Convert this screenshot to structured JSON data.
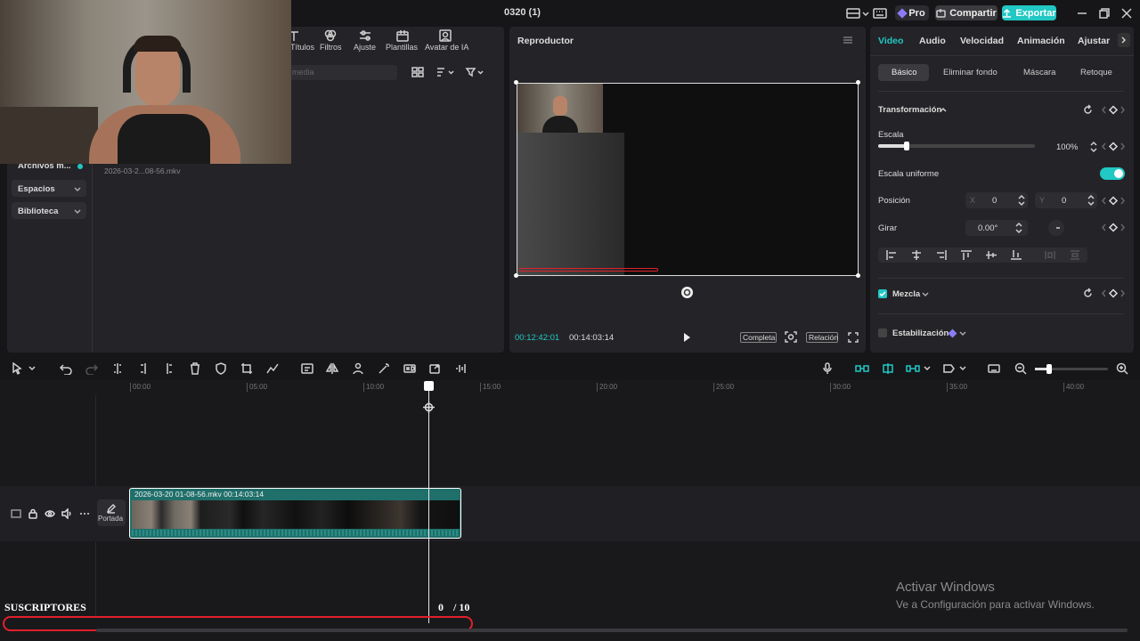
{
  "titlebar": {
    "title": "0320 (1)",
    "pro_label": "Pro",
    "share_label": "Compartir",
    "export_label": "Exportar"
  },
  "media_toolbar": {
    "tabs": [
      "Títulos",
      "Filtros",
      "Ajuste",
      "Plantillas",
      "Avatar de IA"
    ],
    "search_placeholder": "media"
  },
  "left_nav": {
    "items": [
      "Archivos m...",
      "Espacios",
      "Biblioteca"
    ]
  },
  "media": {
    "file_name": "2026-03-2...08-56.mkv"
  },
  "player": {
    "title": "Reproductor",
    "current_time": "00:12:42:01",
    "total_time": "00:14:03:14",
    "full_label": "Completa",
    "ratio_label": "Relación"
  },
  "inspector": {
    "tabs": [
      "Video",
      "Audio",
      "Velocidad",
      "Animación",
      "Ajustar"
    ],
    "subtabs": [
      "Básico",
      "Eliminar fondo",
      "Máscara",
      "Retoque"
    ],
    "transform_label": "Transformación",
    "scale_label": "Escala",
    "scale_value": "100%",
    "scale_level": 0.18,
    "uniform_label": "Escala uniforme",
    "position_label": "Posición",
    "x_label": "X",
    "x_value": "0",
    "y_label": "Y",
    "y_value": "0",
    "rotate_label": "Girar",
    "rotate_value": "0.00°",
    "blend_label": "Mezcla",
    "stabilize_label": "Estabilización"
  },
  "timeline": {
    "ruler": [
      "00:00",
      "05:00",
      "10:00",
      "15:00",
      "20:00",
      "25:00",
      "30:00",
      "35:00",
      "40:00"
    ],
    "clip_label": "2026-03-20 01-08-56.mkv   00:14:03:14",
    "cover_label": "Portada",
    "zoom_level": 0.2
  },
  "overlay": {
    "subs_label": "SUSCRIPTORES",
    "subs_count": "0",
    "subs_goal": "/ 10",
    "subs_progress": 0
  },
  "watermark": {
    "title": "Activar Windows",
    "subtitle": "Ve a Configuración para activar Windows."
  },
  "colors": {
    "accent": "#21c8c4",
    "clip": "#1f6f6a",
    "progress": "#e0202a",
    "pro": "#8b7cf6"
  }
}
